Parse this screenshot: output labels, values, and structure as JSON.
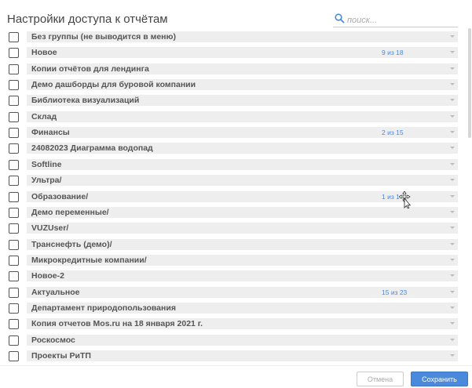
{
  "title": "Настройки доступа к отчётам",
  "search": {
    "placeholder": "поиск..."
  },
  "rows": [
    {
      "label": "Без группы (не выводится в меню)",
      "count": ""
    },
    {
      "label": "Новое",
      "count": "9 из 18"
    },
    {
      "label": "Копии отчётов для лендинга",
      "count": ""
    },
    {
      "label": "Демо дашборды для буровой компании",
      "count": ""
    },
    {
      "label": "Библиотека визуализаций",
      "count": ""
    },
    {
      "label": "Склад",
      "count": ""
    },
    {
      "label": "Финансы",
      "count": "2 из 15"
    },
    {
      "label": "24082023 Диаграмма водопад",
      "count": ""
    },
    {
      "label": "Softline",
      "count": ""
    },
    {
      "label": "Ультра/",
      "count": ""
    },
    {
      "label": "Образование/",
      "count": "1 из 1"
    },
    {
      "label": "Демо переменные/",
      "count": ""
    },
    {
      "label": "VUZUser/",
      "count": ""
    },
    {
      "label": "Транснефть (демо)/",
      "count": ""
    },
    {
      "label": "Микрокредитные компании/",
      "count": ""
    },
    {
      "label": "Новое-2",
      "count": ""
    },
    {
      "label": "Актуальное",
      "count": "15 из 23"
    },
    {
      "label": "Департамент природопользования",
      "count": ""
    },
    {
      "label": "Копия отчетов Mos.ru на 18 января 2021 г.",
      "count": ""
    },
    {
      "label": "Роскосмос",
      "count": ""
    },
    {
      "label": "Проекты РиТП",
      "count": ""
    }
  ],
  "buttons": {
    "cancel": "Отмена",
    "save": "Сохранить"
  },
  "colors": {
    "accent": "#4a89dc",
    "row_bg": "#eeeeee"
  }
}
